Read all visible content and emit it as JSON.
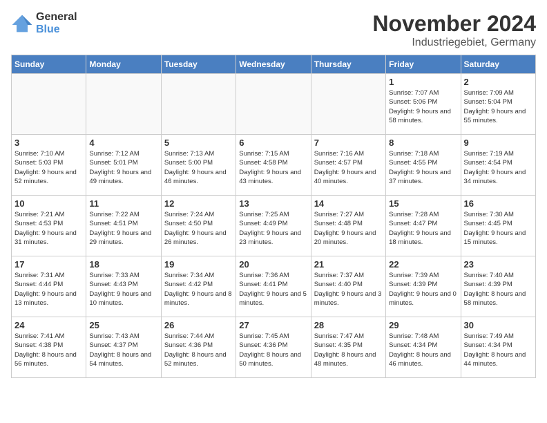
{
  "logo": {
    "general": "General",
    "blue": "Blue"
  },
  "title": "November 2024",
  "location": "Industriegebiet, Germany",
  "days_of_week": [
    "Sunday",
    "Monday",
    "Tuesday",
    "Wednesday",
    "Thursday",
    "Friday",
    "Saturday"
  ],
  "weeks": [
    [
      {
        "day": "",
        "info": ""
      },
      {
        "day": "",
        "info": ""
      },
      {
        "day": "",
        "info": ""
      },
      {
        "day": "",
        "info": ""
      },
      {
        "day": "",
        "info": ""
      },
      {
        "day": "1",
        "info": "Sunrise: 7:07 AM\nSunset: 5:06 PM\nDaylight: 9 hours and 58 minutes."
      },
      {
        "day": "2",
        "info": "Sunrise: 7:09 AM\nSunset: 5:04 PM\nDaylight: 9 hours and 55 minutes."
      }
    ],
    [
      {
        "day": "3",
        "info": "Sunrise: 7:10 AM\nSunset: 5:03 PM\nDaylight: 9 hours and 52 minutes."
      },
      {
        "day": "4",
        "info": "Sunrise: 7:12 AM\nSunset: 5:01 PM\nDaylight: 9 hours and 49 minutes."
      },
      {
        "day": "5",
        "info": "Sunrise: 7:13 AM\nSunset: 5:00 PM\nDaylight: 9 hours and 46 minutes."
      },
      {
        "day": "6",
        "info": "Sunrise: 7:15 AM\nSunset: 4:58 PM\nDaylight: 9 hours and 43 minutes."
      },
      {
        "day": "7",
        "info": "Sunrise: 7:16 AM\nSunset: 4:57 PM\nDaylight: 9 hours and 40 minutes."
      },
      {
        "day": "8",
        "info": "Sunrise: 7:18 AM\nSunset: 4:55 PM\nDaylight: 9 hours and 37 minutes."
      },
      {
        "day": "9",
        "info": "Sunrise: 7:19 AM\nSunset: 4:54 PM\nDaylight: 9 hours and 34 minutes."
      }
    ],
    [
      {
        "day": "10",
        "info": "Sunrise: 7:21 AM\nSunset: 4:53 PM\nDaylight: 9 hours and 31 minutes."
      },
      {
        "day": "11",
        "info": "Sunrise: 7:22 AM\nSunset: 4:51 PM\nDaylight: 9 hours and 29 minutes."
      },
      {
        "day": "12",
        "info": "Sunrise: 7:24 AM\nSunset: 4:50 PM\nDaylight: 9 hours and 26 minutes."
      },
      {
        "day": "13",
        "info": "Sunrise: 7:25 AM\nSunset: 4:49 PM\nDaylight: 9 hours and 23 minutes."
      },
      {
        "day": "14",
        "info": "Sunrise: 7:27 AM\nSunset: 4:48 PM\nDaylight: 9 hours and 20 minutes."
      },
      {
        "day": "15",
        "info": "Sunrise: 7:28 AM\nSunset: 4:47 PM\nDaylight: 9 hours and 18 minutes."
      },
      {
        "day": "16",
        "info": "Sunrise: 7:30 AM\nSunset: 4:45 PM\nDaylight: 9 hours and 15 minutes."
      }
    ],
    [
      {
        "day": "17",
        "info": "Sunrise: 7:31 AM\nSunset: 4:44 PM\nDaylight: 9 hours and 13 minutes."
      },
      {
        "day": "18",
        "info": "Sunrise: 7:33 AM\nSunset: 4:43 PM\nDaylight: 9 hours and 10 minutes."
      },
      {
        "day": "19",
        "info": "Sunrise: 7:34 AM\nSunset: 4:42 PM\nDaylight: 9 hours and 8 minutes."
      },
      {
        "day": "20",
        "info": "Sunrise: 7:36 AM\nSunset: 4:41 PM\nDaylight: 9 hours and 5 minutes."
      },
      {
        "day": "21",
        "info": "Sunrise: 7:37 AM\nSunset: 4:40 PM\nDaylight: 9 hours and 3 minutes."
      },
      {
        "day": "22",
        "info": "Sunrise: 7:39 AM\nSunset: 4:39 PM\nDaylight: 9 hours and 0 minutes."
      },
      {
        "day": "23",
        "info": "Sunrise: 7:40 AM\nSunset: 4:39 PM\nDaylight: 8 hours and 58 minutes."
      }
    ],
    [
      {
        "day": "24",
        "info": "Sunrise: 7:41 AM\nSunset: 4:38 PM\nDaylight: 8 hours and 56 minutes."
      },
      {
        "day": "25",
        "info": "Sunrise: 7:43 AM\nSunset: 4:37 PM\nDaylight: 8 hours and 54 minutes."
      },
      {
        "day": "26",
        "info": "Sunrise: 7:44 AM\nSunset: 4:36 PM\nDaylight: 8 hours and 52 minutes."
      },
      {
        "day": "27",
        "info": "Sunrise: 7:45 AM\nSunset: 4:36 PM\nDaylight: 8 hours and 50 minutes."
      },
      {
        "day": "28",
        "info": "Sunrise: 7:47 AM\nSunset: 4:35 PM\nDaylight: 8 hours and 48 minutes."
      },
      {
        "day": "29",
        "info": "Sunrise: 7:48 AM\nSunset: 4:34 PM\nDaylight: 8 hours and 46 minutes."
      },
      {
        "day": "30",
        "info": "Sunrise: 7:49 AM\nSunset: 4:34 PM\nDaylight: 8 hours and 44 minutes."
      }
    ]
  ]
}
